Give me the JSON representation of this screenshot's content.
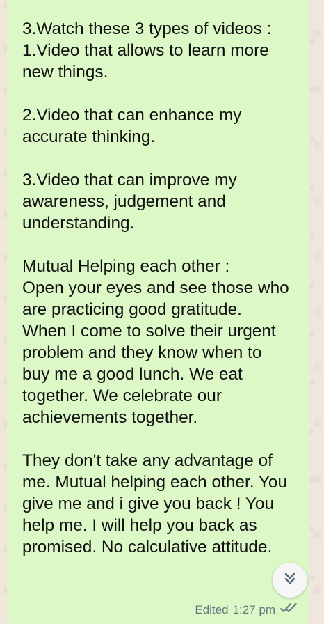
{
  "message": {
    "text": "3.Watch these 3 types of videos :\n1.Video that allows to learn more new things.\n\n2.Video that can enhance my accurate thinking.\n\n3.Video that can improve my awareness, judgement and understanding.\n\nMutual Helping each other :\nOpen your eyes and see those who are practicing good gratitude.\nWhen I come to solve their urgent problem and they know when to buy me a good lunch. We eat together. We celebrate our achievements together.\n\nThey don't take any advantage of me. Mutual helping each other. You give me and i give you back ! You help me. I will help you back as promised. No calculative attitude.",
    "edited_label": "Edited",
    "time": "1:27 pm",
    "status_icon": "double-check-icon",
    "status_color": "#667781"
  },
  "scroll_button": {
    "icon": "double-chevron-down-icon"
  },
  "colors": {
    "bubble": "#dcf8c6",
    "wallpaper": "#efe7de",
    "text": "#111111"
  }
}
